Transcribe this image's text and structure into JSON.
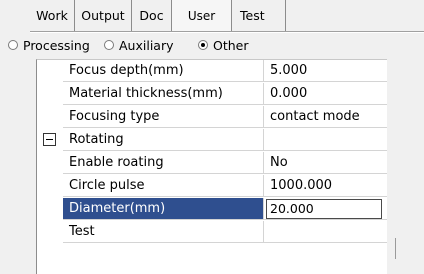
{
  "tabs": [
    {
      "label": "Work",
      "active": false
    },
    {
      "label": "Output",
      "active": false
    },
    {
      "label": "Doc",
      "active": false
    },
    {
      "label": "User",
      "active": true
    },
    {
      "label": "Test",
      "active": false
    }
  ],
  "modes": [
    {
      "label": "Processing",
      "checked": false
    },
    {
      "label": "Auxiliary",
      "checked": false
    },
    {
      "label": "Other",
      "checked": true
    }
  ],
  "properties": [
    {
      "name": "Focus depth(mm)",
      "value": "5.000"
    },
    {
      "name": "Material thickness(mm)",
      "value": "0.000"
    },
    {
      "name": "Focusing type",
      "value": "contact mode"
    },
    {
      "name": "Rotating",
      "value": "",
      "category": true
    },
    {
      "name": "Enable roating",
      "value": "No"
    },
    {
      "name": "Circle pulse",
      "value": "1000.000"
    },
    {
      "name": "Diameter(mm)",
      "value": "20.000",
      "selected": true
    },
    {
      "name": "Test",
      "value": ""
    }
  ]
}
